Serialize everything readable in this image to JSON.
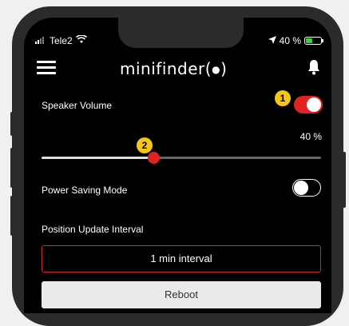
{
  "status_bar": {
    "carrier": "Tele2",
    "battery_text": "40 %"
  },
  "header": {
    "logo_text": "minifinder",
    "menu_icon": "hamburger-menu-icon",
    "bell_icon": "bell-icon"
  },
  "settings": {
    "speaker_volume": {
      "label": "Speaker Volume",
      "enabled": true,
      "badge": "1",
      "value_text": "40 %",
      "value": 0.4,
      "slider_badge": "2"
    },
    "power_saving": {
      "label": "Power Saving Mode",
      "enabled": false
    },
    "position_update": {
      "label": "Position Update Interval",
      "value": "1 min interval"
    },
    "reboot_label": "Reboot"
  },
  "colors": {
    "accent": "#e02222",
    "badge": "#f5c518"
  }
}
